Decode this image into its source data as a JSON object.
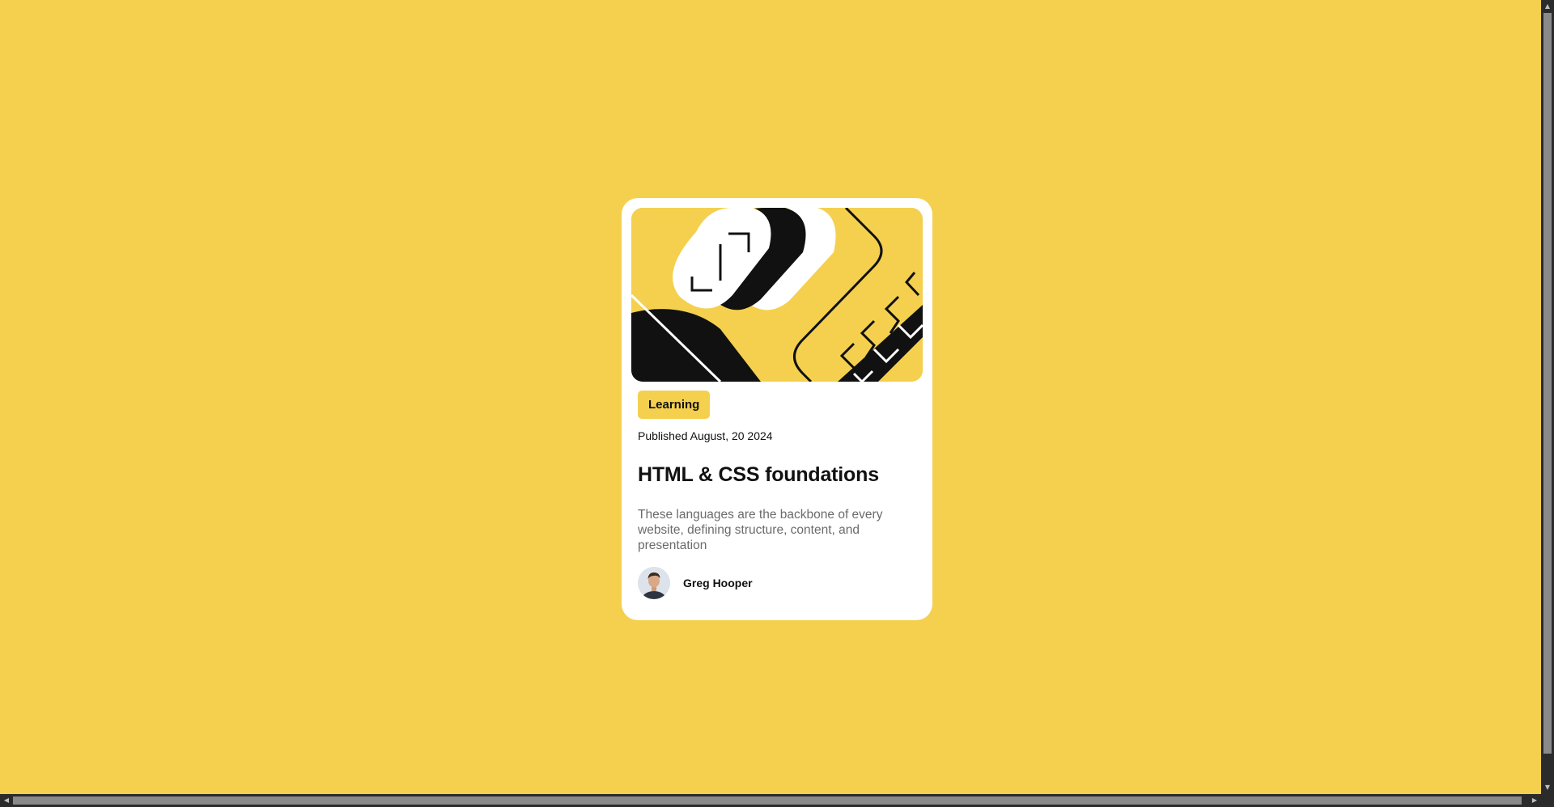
{
  "page": {
    "background_color": "#F4D04E"
  },
  "card": {
    "image": {
      "icon": "abstract-illustration-icon"
    },
    "tag_label": "Learning",
    "published": "Published August, 20 2024",
    "title": "HTML & CSS foundations",
    "description": "These languages are the backbone of every website, defining structure, content, and presentation",
    "author": {
      "name": "Greg Hooper",
      "avatar_icon": "avatar-icon"
    }
  },
  "scrollbars": {
    "up_arrow": "▲",
    "down_arrow": "▼",
    "left_arrow": "◀",
    "right_arrow": "▶"
  }
}
